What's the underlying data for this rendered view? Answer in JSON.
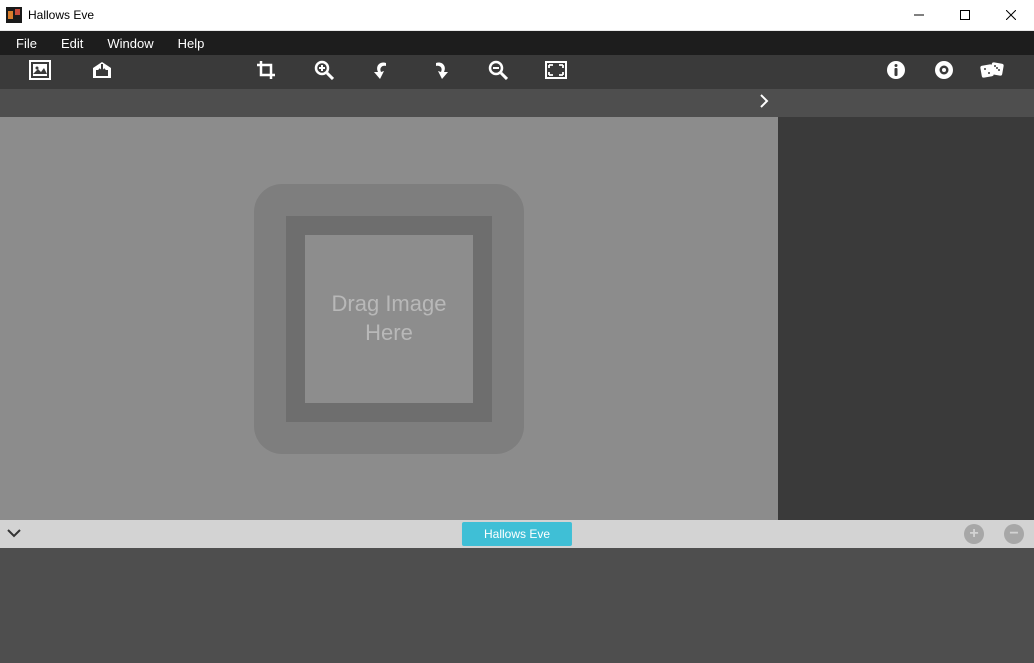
{
  "window": {
    "title": "Hallows Eve"
  },
  "menu": {
    "file": "File",
    "edit": "Edit",
    "window": "Window",
    "help": "Help"
  },
  "toolbar_icons": {
    "open": "open-image-icon",
    "save": "save-icon",
    "crop": "crop-icon",
    "zoom_in": "zoom-in-icon",
    "undo": "undo-icon",
    "redo": "redo-icon",
    "zoom_out": "zoom-out-icon",
    "fit": "fit-screen-icon",
    "info": "info-icon",
    "settings": "target-icon",
    "dice": "dice-icon"
  },
  "canvas": {
    "drop_line1": "Drag Image",
    "drop_line2": "Here"
  },
  "footer": {
    "chip_label": "Hallows Eve",
    "plus": "+",
    "minus": "−"
  }
}
